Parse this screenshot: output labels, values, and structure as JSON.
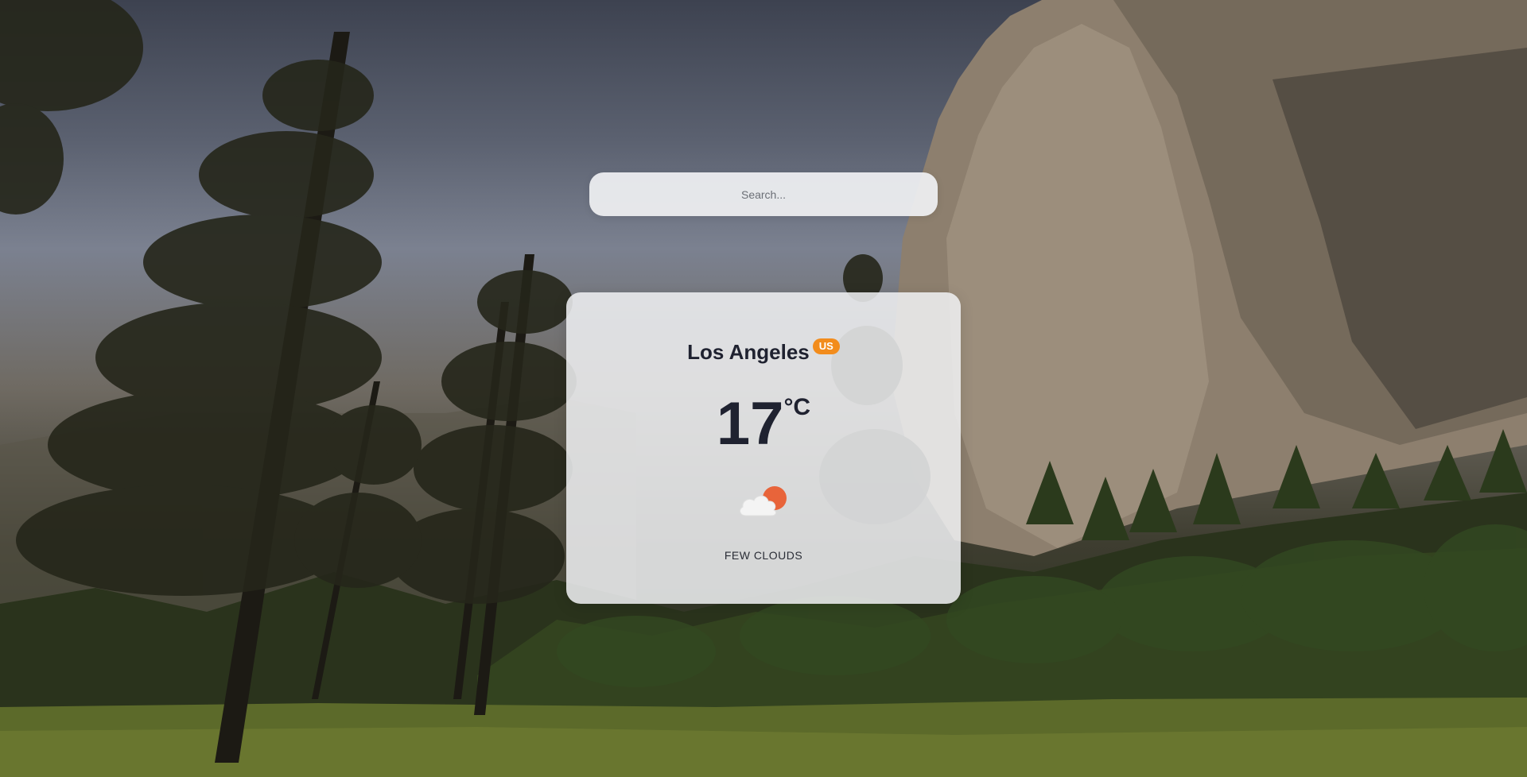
{
  "search": {
    "placeholder": "Search...",
    "value": ""
  },
  "weather": {
    "city": "Los Angeles",
    "country": "US",
    "temperature": "17",
    "unit": "°C",
    "condition": "FEW CLOUDS",
    "icon": "few-clouds-day-icon"
  },
  "colors": {
    "badge": "#f28c1c",
    "text": "#1f2230",
    "sun": "#e8643a",
    "cloud": "#f4f4f4"
  }
}
